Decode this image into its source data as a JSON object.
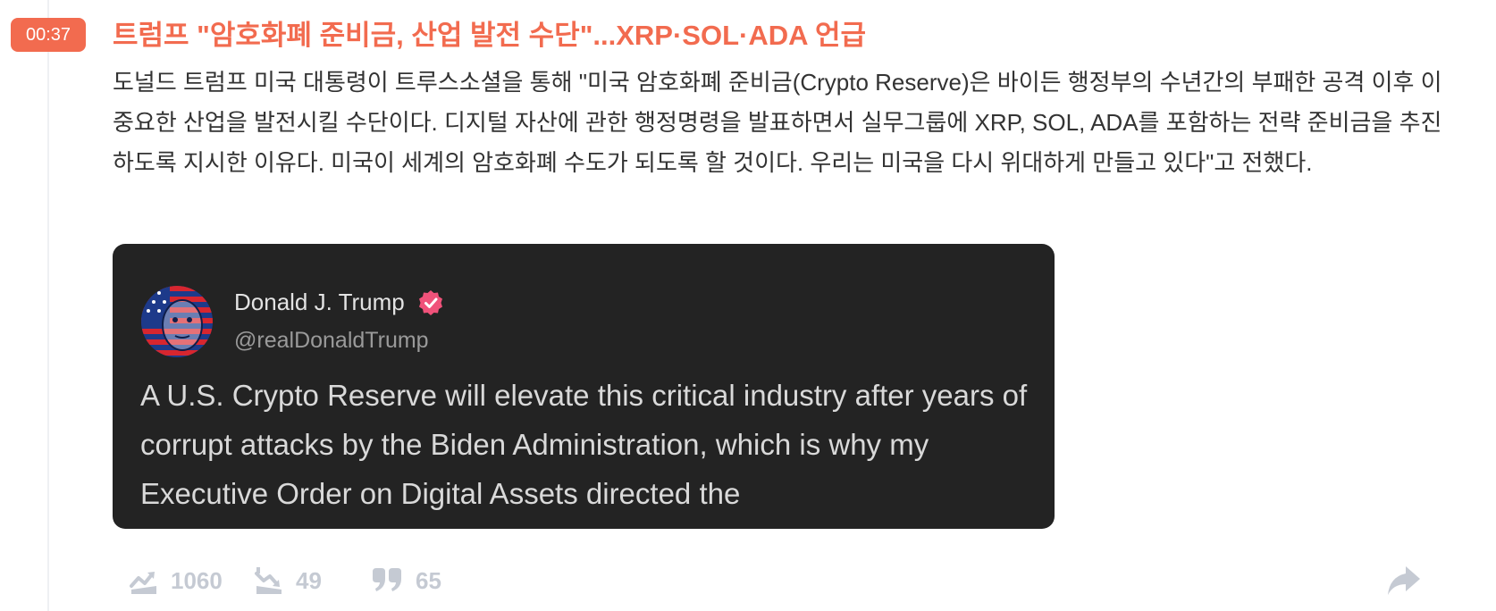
{
  "time_badge": "00:37",
  "headline": "트럼프 \"암호화폐 준비금, 산업 발전 수단\"...XRP·SOL·ADA 언급",
  "body": "도널드 트럼프 미국 대통령이 트루스소셜을 통해 \"미국 암호화폐 준비금(Crypto Reserve)은 바이든 행정부의 수년간의 부패한 공격 이후 이 중요한 산업을 발전시킬 수단이다. 디지털 자산에 관한 행정명령을 발표하면서 실무그룹에 XRP, SOL, ADA를 포함하는 전략 준비금을 추진하도록 지시한 이유다. 미국이 세계의 암호화폐 수도가 되도록 할 것이다. 우리는 미국을 다시 위대하게 만들고 있다\"고 전했다.",
  "tweet": {
    "author": "Donald J. Trump",
    "handle": "@realDonaldTrump",
    "text": "A U.S. Crypto Reserve will elevate this critical industry after years of corrupt attacks by the Biden Administration, which is why my Executive Order on Digital Assets directed the",
    "verified_icon": "verified-badge-icon",
    "verified_color": "#f0527a"
  },
  "actions": {
    "bullish": {
      "icon": "trend-up-icon",
      "count": "1060"
    },
    "bearish": {
      "icon": "trend-down-icon",
      "count": "49"
    },
    "comments": {
      "icon": "quote-icon",
      "count": "65"
    },
    "share": {
      "icon": "share-arrow-icon"
    }
  },
  "colors": {
    "accent": "#f26b4f",
    "text": "#333333",
    "card_bg": "#232323",
    "action_icon": "#c5cad3"
  }
}
